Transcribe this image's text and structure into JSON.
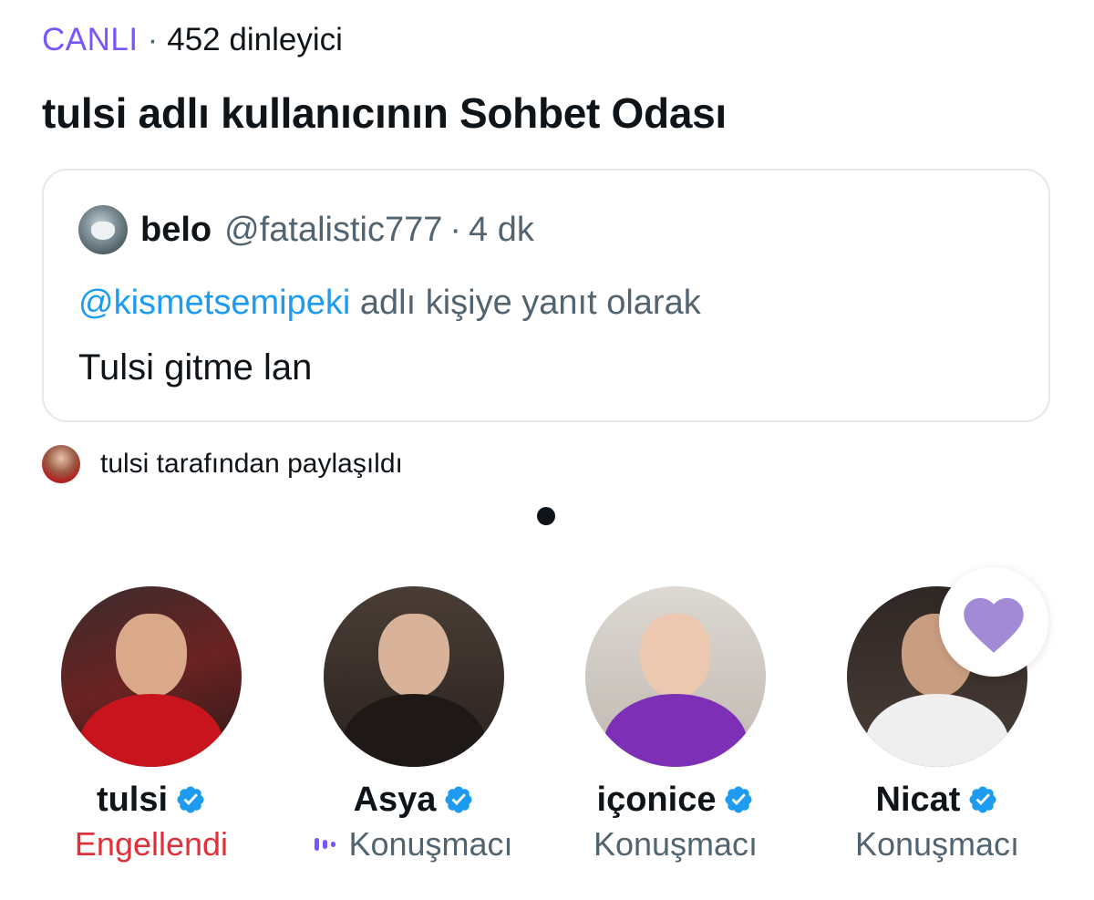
{
  "space": {
    "live_label": "CANLI",
    "separator": "·",
    "listeners": "452 dinleyici",
    "title": "tulsi adlı kullanıcının Sohbet Odası"
  },
  "quote": {
    "name": "belo",
    "handle": "@fatalistic777",
    "dot": "·",
    "time": "4 dk",
    "reply_mention": "@kismetsemipeki",
    "reply_text": "adlı kişiye yanıt olarak",
    "text": "Tulsi gitme lan"
  },
  "shared_by": "tulsi tarafından paylaşıldı",
  "speakers": [
    {
      "name": "tulsi",
      "role": "Engellendi",
      "status": "blocked"
    },
    {
      "name": "Asya",
      "role": "Konuşmacı",
      "status": "speaking"
    },
    {
      "name": "içonice",
      "role": "Konuşmacı",
      "status": "idle"
    },
    {
      "name": "Nicat",
      "role": "Konuşmacı",
      "status": "idle"
    }
  ],
  "colors": {
    "accent_purple": "#7856ff",
    "link_blue": "#1d9bf0",
    "verified_blue": "#1d9bf0",
    "blocked_red": "#e0303a",
    "heart": "#a38ad6"
  },
  "icons": {
    "verified": "verified-badge-icon",
    "heart": "heart-icon",
    "speaking": "audio-wave-icon"
  }
}
